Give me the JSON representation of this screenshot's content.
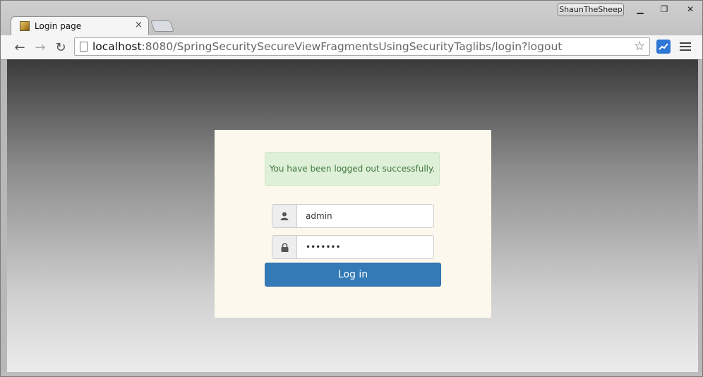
{
  "window": {
    "profile_name": "ShaunTheSheep",
    "controls": {
      "minimize": "▁",
      "restore": "❐",
      "close": "✕"
    }
  },
  "tab": {
    "title": "Login page",
    "close": "×",
    "favicon": "spring-leaf-icon"
  },
  "toolbar": {
    "back": "←",
    "forward": "→",
    "reload": "↻",
    "url_host": "localhost",
    "url_rest": ":8080/SpringSecuritySecureViewFragmentsUsingSecurityTaglibs/login?logout",
    "star": "☆",
    "extension_icon": "chart-extension-icon"
  },
  "login": {
    "alert_message": "You have been logged out successfully.",
    "username_value": "admin",
    "password_value": "•••••••",
    "submit_label": "Log in",
    "colors": {
      "alert_bg": "#dff0d8",
      "alert_text": "#3c763d",
      "button_bg": "#337ab7",
      "card_bg": "#fdf8ee"
    }
  }
}
